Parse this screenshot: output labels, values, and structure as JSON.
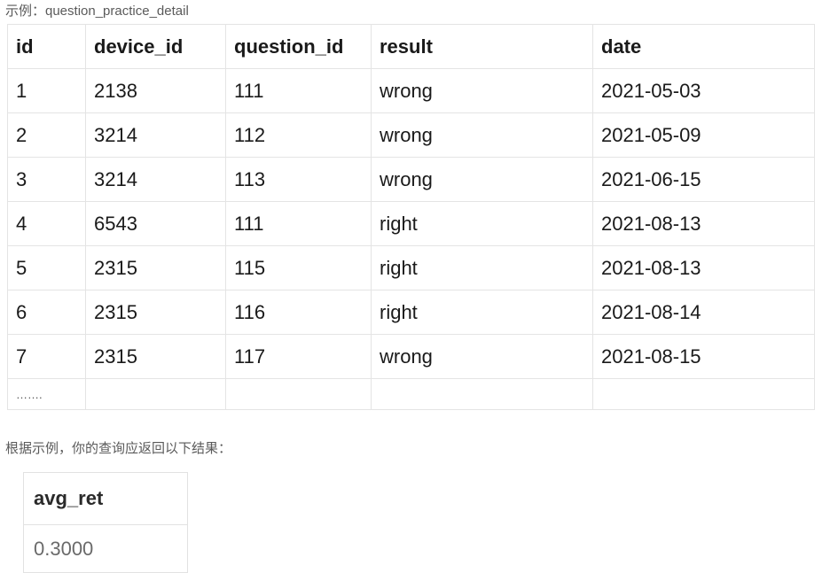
{
  "example_caption": "示例：question_practice_detail",
  "table": {
    "columns": [
      "id",
      "device_id",
      "question_id",
      "result",
      "date"
    ],
    "rows": [
      [
        "1",
        "2138",
        "111",
        "wrong",
        "2021-05-03"
      ],
      [
        "2",
        "3214",
        "112",
        "wrong",
        "2021-05-09"
      ],
      [
        "3",
        "3214",
        "113",
        "wrong",
        "2021-06-15"
      ],
      [
        "4",
        "6543",
        "111",
        "right",
        "2021-08-13"
      ],
      [
        "5",
        "2315",
        "115",
        "right",
        "2021-08-13"
      ],
      [
        "6",
        "2315",
        "116",
        "right",
        "2021-08-14"
      ],
      [
        "7",
        "2315",
        "117",
        "wrong",
        "2021-08-15"
      ]
    ],
    "ellipsis": "……."
  },
  "result_caption": "根据示例，你的查询应返回以下结果：",
  "result_table": {
    "columns": [
      "avg_ret"
    ],
    "rows": [
      [
        "0.3000"
      ]
    ]
  }
}
